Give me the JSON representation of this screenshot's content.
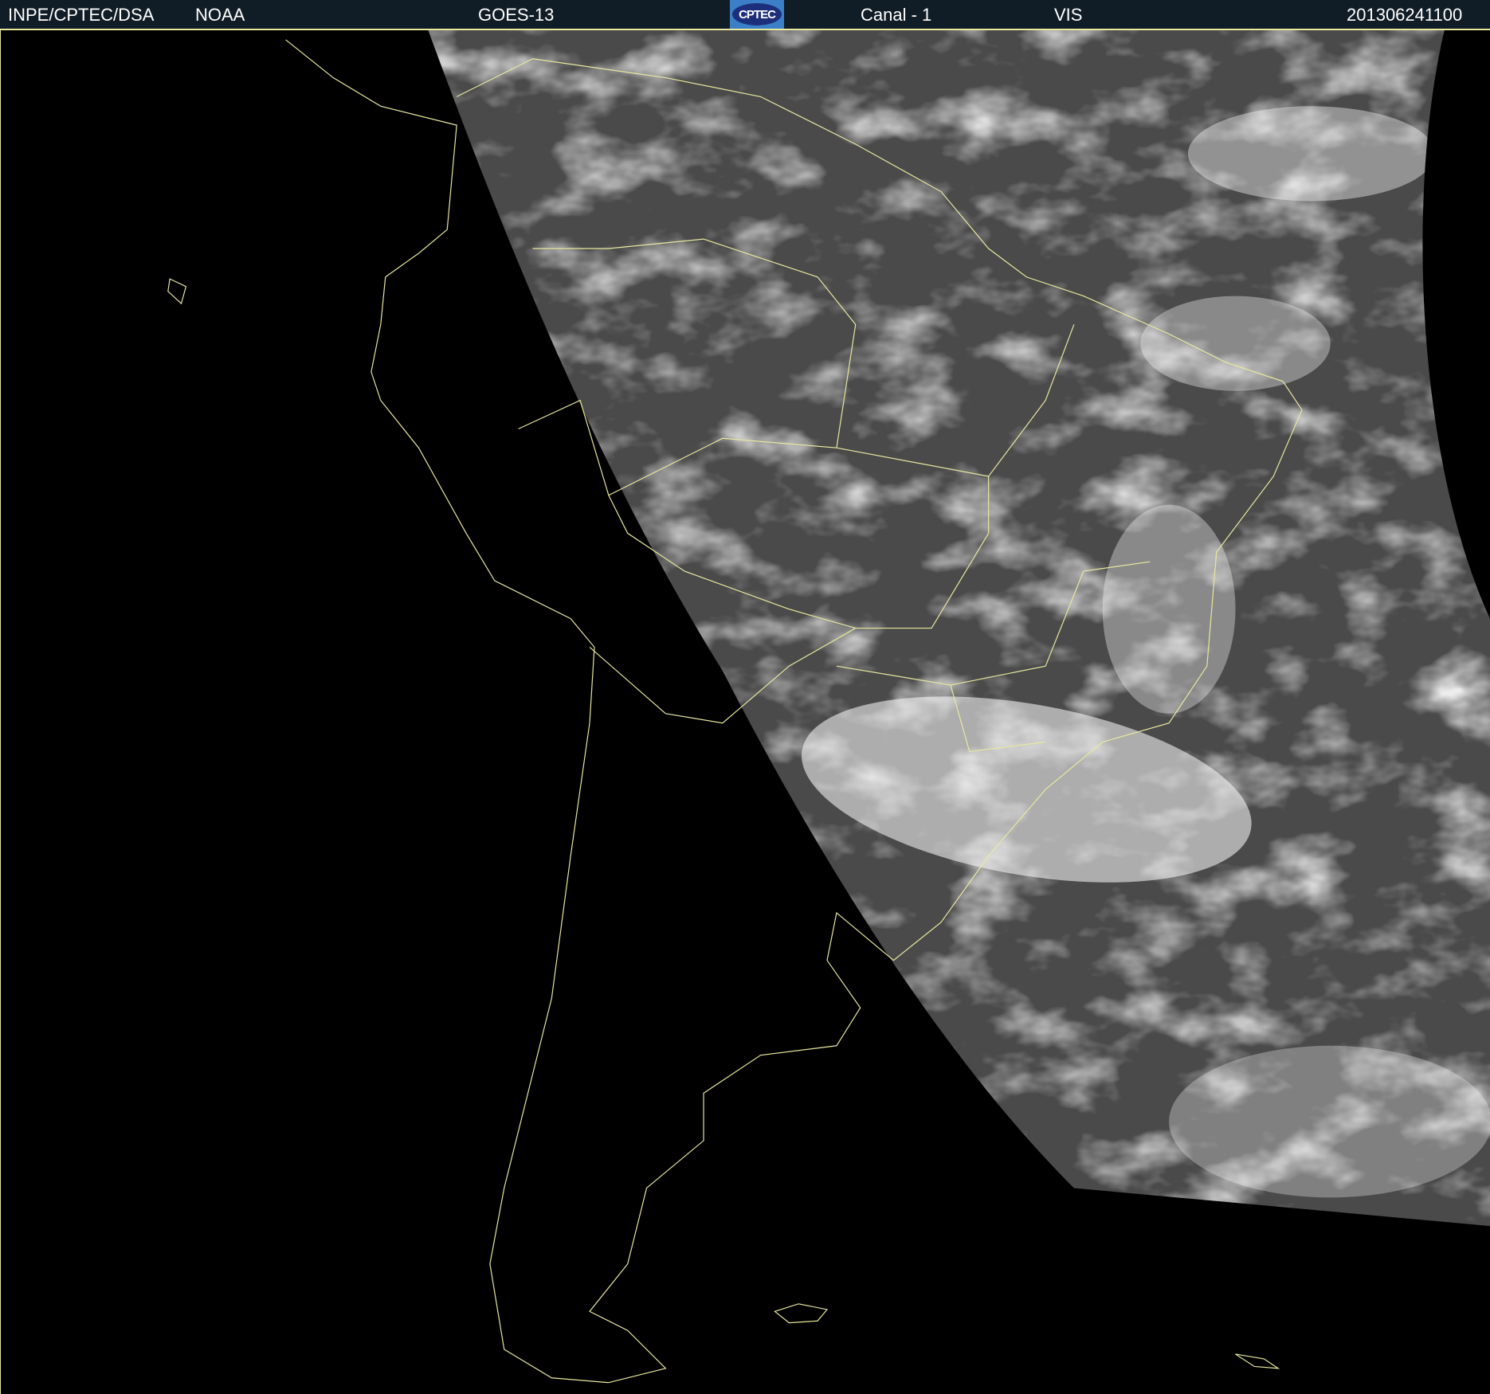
{
  "header": {
    "institution": "INPE/CPTEC/DSA",
    "agency": "NOAA",
    "satellite": "GOES-13",
    "logo_text": "CPTEC",
    "channel": "Canal - 1",
    "band": "VIS",
    "timestamp": "201306241100"
  },
  "colors": {
    "header_bg": "#111d26",
    "coastline": "#e8e8a0",
    "logo_bg": "#3b7fc8"
  }
}
